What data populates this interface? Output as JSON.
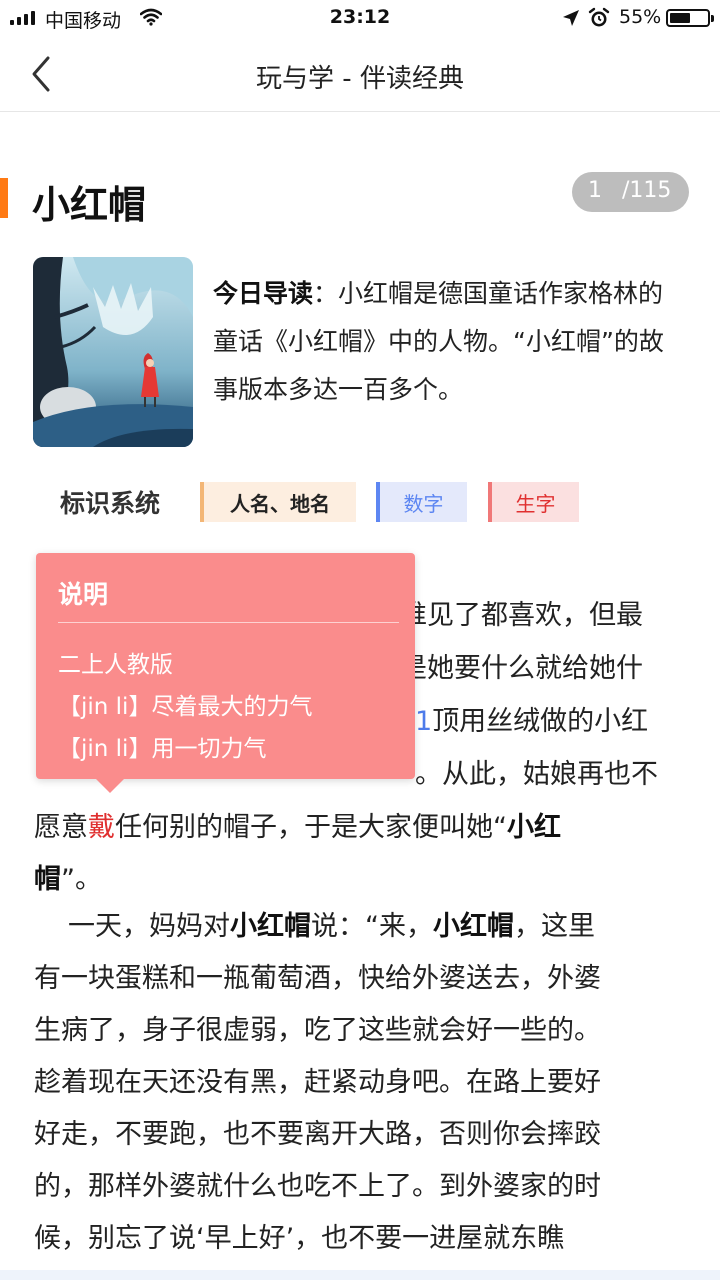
{
  "status": {
    "carrier": "中国移动",
    "time": "23:12",
    "battery_percent": "55%",
    "battery_level": 0.55
  },
  "nav": {
    "title": "玩与学 - 伴读经典"
  },
  "story": {
    "title": "小红帽",
    "page_current": "1",
    "page_total": "/115",
    "intro_label": "今日导读",
    "intro_text": "：小红帽是德国童话作家格林的童话《小红帽》中的人物。“小红帽”的故事版本多达一百多个。"
  },
  "legend": {
    "label": "标识系统",
    "tags": [
      "人名、地名",
      "数字",
      "生字"
    ]
  },
  "popup": {
    "title": "说明",
    "lines": [
      "二上人教版",
      "【jin li】尽着最大的力气",
      "【jin li】用一切力气"
    ]
  },
  "body_lines": {
    "l1": "谁见了都喜欢，但最",
    "l2": "是她要什么就给她什",
    "l3_num": "1",
    "l3": "顶用丝绒做的小红",
    "l4": "。从此，姑娘再也不",
    "l5_a": "愿意",
    "l5_red": "戴",
    "l5_b": "任何别的帽子，于是大家便叫她“",
    "l5_bold": "小红",
    "l6_bold": "帽",
    "l6": "”。",
    "l7_a": "一天，妈妈对",
    "l7_bold1": "小红帽",
    "l7_b": "说：“来，",
    "l7_bold2": "小红帽",
    "l7_c": "，这里",
    "l8": "有一块蛋糕和一瓶葡萄酒，快给外婆送去，外婆",
    "l9": "生病了，身子很虚弱，吃了这些就会好一些的。",
    "l10": "趁着现在天还没有黑，赶紧动身吧。在路上要好",
    "l11": "好走，不要跑，也不要离开大路，否则你会摔跤",
    "l12": "的，那样外婆就什么也吃不上了。到外婆家的时",
    "l13": "候，别忘了说‘早上好’，也不要一进屋就东瞧"
  },
  "colors": {
    "accent": "#ff7a14",
    "popup": "#fa8c8c",
    "new_char": "#e03030",
    "number": "#4d7bea"
  },
  "icons": [
    "signal-icon",
    "wifi-icon",
    "location-arrow-icon",
    "alarm-icon",
    "battery-icon",
    "back-chevron-icon"
  ]
}
